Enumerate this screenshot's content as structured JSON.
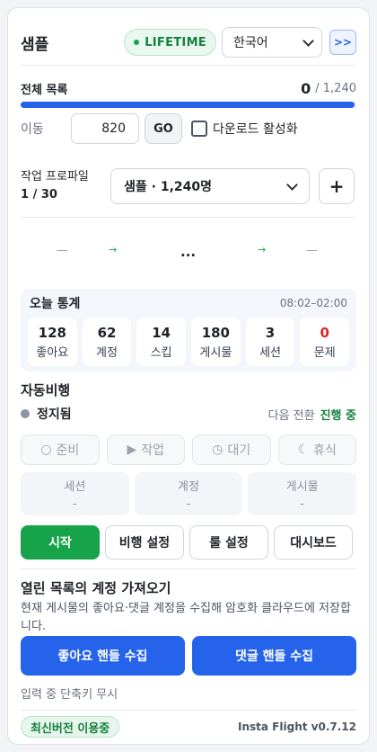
{
  "header": {
    "title": "샘플",
    "badge": "LIFETIME",
    "language": "한국어",
    "collapse_label": ">>"
  },
  "list": {
    "label": "전체 목록",
    "current": "0",
    "total": "/ 1,240",
    "progress": 0.995
  },
  "jump": {
    "label": "이동",
    "value": "820",
    "go_label": "GO",
    "download_label": "다운로드 활성화",
    "download_checked": false
  },
  "profile": {
    "label_line1": "작업 프로파일",
    "label_line2": "1 / 30",
    "selected": "샘플 · 1,240명",
    "add_label": "+"
  },
  "flow": {
    "left": "—",
    "arrow": "→",
    "middle": "...",
    "right": "—"
  },
  "stats": {
    "title": "오늘 통계",
    "time_range": "08:02–02:00",
    "items": [
      {
        "value": "128",
        "label": "좋아요",
        "color": "#1f2328"
      },
      {
        "value": "62",
        "label": "계정",
        "color": "#1f2328"
      },
      {
        "value": "14",
        "label": "스킵",
        "color": "#1f2328"
      },
      {
        "value": "180",
        "label": "게시물",
        "color": "#1f2328"
      },
      {
        "value": "3",
        "label": "세션",
        "color": "#1f2328"
      },
      {
        "value": "0",
        "label": "문제",
        "color": "#dc2626"
      }
    ]
  },
  "autopilot": {
    "title": "자동비행",
    "status": "정지됨",
    "next_label": "다음 전환",
    "next_value": "진행 중",
    "phases": [
      {
        "icon": "○",
        "label": "준비"
      },
      {
        "icon": "▶",
        "label": "작업"
      },
      {
        "icon": "◷",
        "label": "대기"
      },
      {
        "icon": "☾",
        "label": "휴식"
      }
    ],
    "info": [
      {
        "label": "세션",
        "value": "-"
      },
      {
        "label": "계정",
        "value": "-"
      },
      {
        "label": "게시물",
        "value": "-"
      }
    ],
    "start_label": "시작",
    "flight_settings_label": "비행 설정",
    "rule_settings_label": "룰 설정",
    "dashboard_label": "대시보드"
  },
  "import": {
    "title": "열린 목록의 계정 가져오기",
    "description": "현재 게시물의 좋아요·댓글 계정을 수집해 암호화 클라우드에 저장합니다.",
    "likes_button": "좋아요 핸들 수집",
    "comments_button": "댓글 핸들 수집",
    "hint": "입력 중 단축키 무시"
  },
  "footer": {
    "version_badge": "최신버전 이용중",
    "app_version": "Insta Flight v0.7.12"
  },
  "colors": {
    "accent": "#2563eb",
    "start": "#16a34a",
    "success": "#15803d",
    "danger": "#dc2626"
  }
}
